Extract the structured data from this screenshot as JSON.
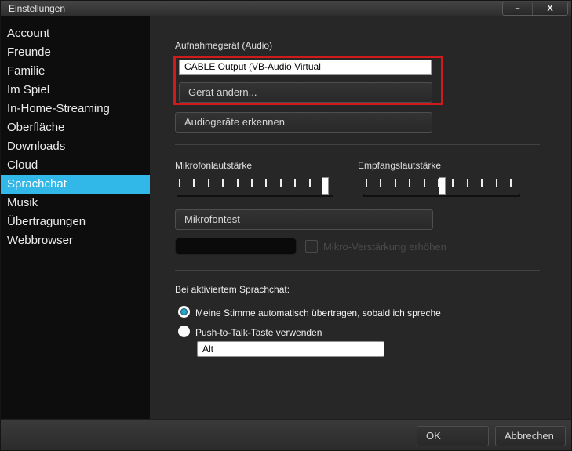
{
  "window": {
    "title": "Einstellungen",
    "minimize_glyph": "–",
    "close_glyph": "X"
  },
  "sidebar": {
    "items": [
      {
        "label": "Account",
        "selected": false
      },
      {
        "label": "Freunde",
        "selected": false
      },
      {
        "label": "Familie",
        "selected": false
      },
      {
        "label": "Im Spiel",
        "selected": false
      },
      {
        "label": "In-Home-Streaming",
        "selected": false
      },
      {
        "label": "Oberfläche",
        "selected": false
      },
      {
        "label": "Downloads",
        "selected": false
      },
      {
        "label": "Cloud",
        "selected": false
      },
      {
        "label": "Sprachchat",
        "selected": true
      },
      {
        "label": "Musik",
        "selected": false
      },
      {
        "label": "Übertragungen",
        "selected": false
      },
      {
        "label": "Webbrowser",
        "selected": false
      }
    ]
  },
  "main": {
    "recording_device": {
      "label": "Aufnahmegerät (Audio)",
      "value": "CABLE Output (VB-Audio Virtual",
      "change_button": "Gerät ändern...",
      "detect_button": "Audiogeräte erkennen"
    },
    "sliders": [
      {
        "label": "Mikrofonlautstärke",
        "value_pct": 97
      },
      {
        "label": "Empfangslautstärke",
        "value_pct": 50
      }
    ],
    "mic_test_button": "Mikrofontest",
    "mic_boost_checkbox": {
      "label": "Mikro-Verstärkung erhöhen",
      "checked": false,
      "disabled": true
    },
    "voice_section": {
      "label": "Bei aktiviertem Sprachchat:",
      "options": [
        {
          "label": "Meine Stimme automatisch übertragen, sobald ich spreche",
          "selected": true
        },
        {
          "label": "Push-to-Talk-Taste verwenden",
          "selected": false
        }
      ],
      "push_to_talk_key": "Alt"
    }
  },
  "footer": {
    "ok_label": "OK",
    "cancel_label": "Abbrechen"
  },
  "colors": {
    "accent": "#31b7e8",
    "radio_fill": "#2ba3cf",
    "annotation_red": "#cf1b1b"
  }
}
